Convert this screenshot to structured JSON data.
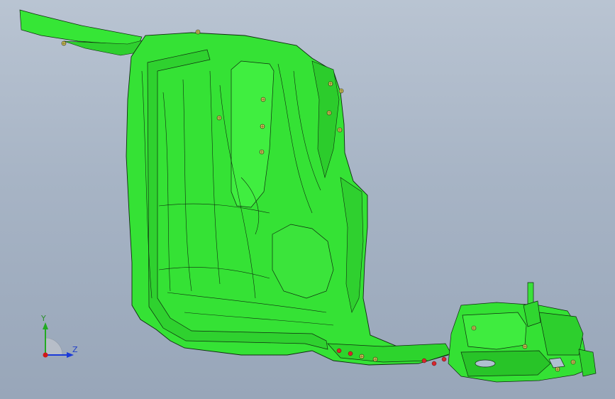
{
  "viewer": {
    "background_top": "#b9c4d2",
    "background_bottom": "#98a6b9",
    "part_color": "#33e533",
    "edge_color": "#0f2b0f"
  },
  "triad": {
    "y_label": "Y",
    "z_label": "Z",
    "y_color": "#22aa22",
    "z_color": "#1a3ad8",
    "x_color": "#d01818"
  },
  "icons": {
    "hole_marker": "hole-marker-icon",
    "weld_point": "weld-point-icon"
  }
}
